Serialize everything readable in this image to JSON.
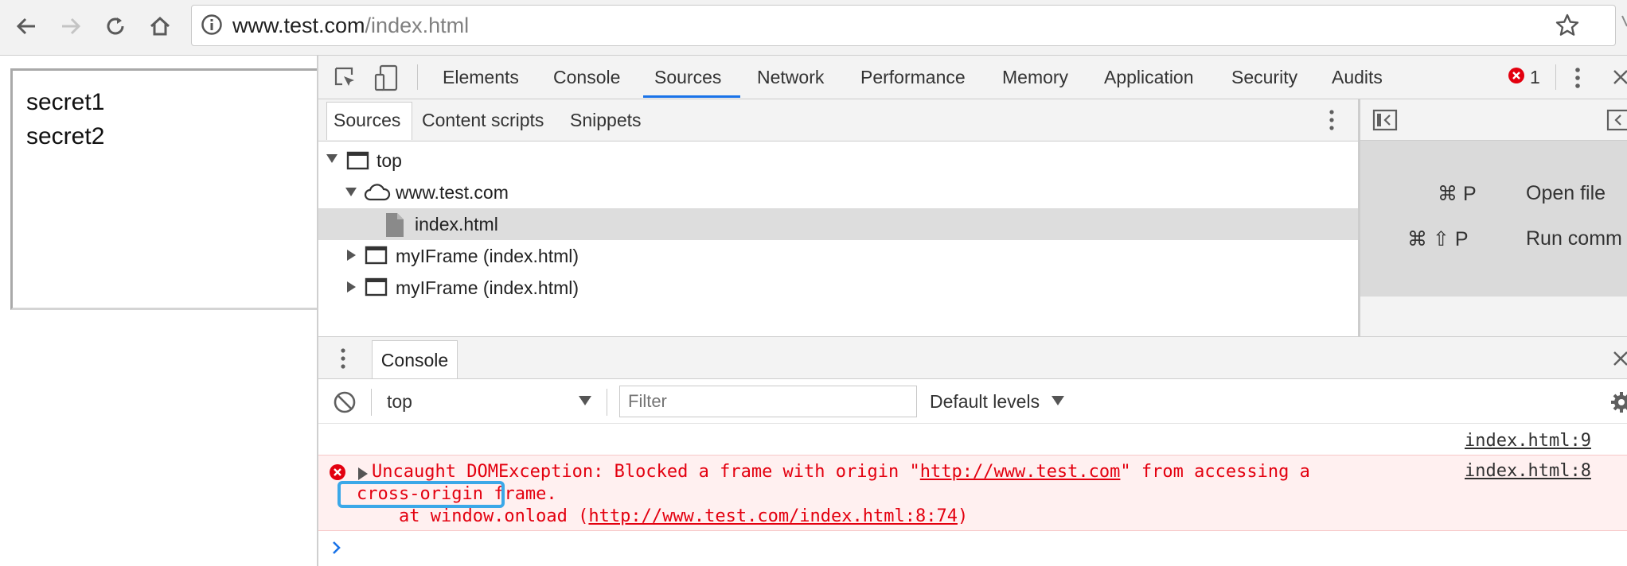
{
  "browser": {
    "url_host": "www.test.com",
    "url_path": "/index.html"
  },
  "page": {
    "lines": [
      "secret1",
      "secret2"
    ]
  },
  "devtools": {
    "tabs": [
      "Elements",
      "Console",
      "Sources",
      "Network",
      "Performance",
      "Memory",
      "Application",
      "Security",
      "Audits"
    ],
    "active_tab": "Sources",
    "error_count": "1",
    "sources": {
      "subtabs": [
        "Sources",
        "Content scripts",
        "Snippets"
      ],
      "tree": {
        "top": "top",
        "domain": "www.test.com",
        "file": "index.html",
        "frames": [
          "myIFrame (index.html)",
          "myIFrame (index.html)"
        ]
      },
      "shortcuts": [
        {
          "keys": "⌘ P",
          "label": "Open file"
        },
        {
          "keys": "⌘ ⇧ P",
          "label": "Run comm"
        }
      ]
    },
    "console": {
      "drawer_tab": "Console",
      "context": "top",
      "filter_placeholder": "Filter",
      "levels": "Default levels",
      "row1_source": "index.html:9",
      "error": {
        "line1_prefix": "Uncaught DOMException: Blocked a frame with origin \"",
        "line1_link": "http://www.test.com",
        "line1_suffix": "\" from accessing a",
        "line2_highlight": "cross-origin",
        "line2_rest": " frame.",
        "line3_prefix": "    at window.onload (",
        "line3_link": "http://www.test.com/index.html:8:74",
        "line3_suffix": ")",
        "source": "index.html:8"
      }
    }
  },
  "colors": {
    "accent": "#1a73e8",
    "error": "#e3000f",
    "highlight": "#3ba8e8"
  }
}
